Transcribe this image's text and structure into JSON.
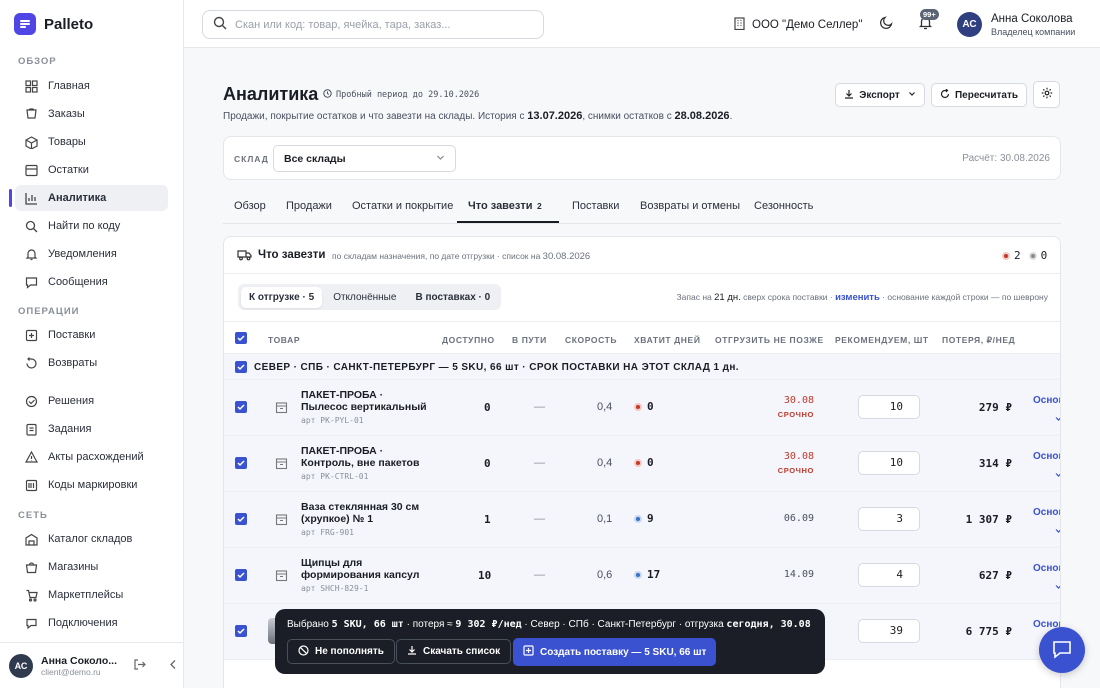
{
  "app": {
    "name": "Palleto"
  },
  "sidebar": {
    "sections": [
      {
        "title": "ОБЗОР"
      },
      {
        "title": "ОПЕРАЦИИ"
      },
      {
        "title": "СЕТЬ"
      }
    ],
    "items": [
      {
        "label": "Главная",
        "icon": "grid-icon"
      },
      {
        "label": "Заказы",
        "icon": "orders-icon"
      },
      {
        "label": "Товары",
        "icon": "products-icon"
      },
      {
        "label": "Остатки",
        "icon": "stock-icon"
      },
      {
        "label": "Аналитика",
        "icon": "chart-icon",
        "active": true
      },
      {
        "label": "Найти по коду",
        "icon": "search-code-icon"
      },
      {
        "label": "Уведомления",
        "icon": "bell-icon"
      },
      {
        "label": "Сообщения",
        "icon": "message-icon"
      },
      {
        "label": "Поставки",
        "icon": "supply-icon"
      },
      {
        "label": "Возвраты",
        "icon": "return-icon"
      },
      {
        "label": "Решения",
        "icon": "decision-icon"
      },
      {
        "label": "Задания",
        "icon": "tasks-icon"
      },
      {
        "label": "Акты расхождений",
        "icon": "acts-icon"
      },
      {
        "label": "Коды маркировки",
        "icon": "barcode-icon"
      },
      {
        "label": "Каталог складов",
        "icon": "warehouse-icon"
      },
      {
        "label": "Магазины",
        "icon": "store-icon"
      },
      {
        "label": "Маркетплейсы",
        "icon": "marketplace-icon"
      },
      {
        "label": "Подключения",
        "icon": "connections-icon"
      }
    ],
    "user": {
      "initials": "АС",
      "name": "Анна Соколо...",
      "email": "client@demo.ru"
    }
  },
  "header": {
    "search_placeholder": "Скан или код: товар, ячейка, тара, заказ...",
    "org": "ООО \"Демо Селлер\"",
    "notif_badge": "99+",
    "user": {
      "initials": "АС",
      "name": "Анна Соколова",
      "role": "Владелец компании"
    }
  },
  "page": {
    "title": "Аналитика",
    "trial": "Пробный период до 29.10.2026",
    "subtitle_pre": "Продажи, покрытие остатков и что завезти на склады. История с ",
    "history_date": "13.07.2026",
    "subtitle_mid": ", снимки остатков с ",
    "snapshot_date": "28.08.2026",
    "subtitle_end": ".",
    "export_label": "Экспорт",
    "recalc_label": "Пересчитать"
  },
  "filter": {
    "label": "СКЛАД",
    "value": "Все склады",
    "calc": "Расчёт: 30.08.2026"
  },
  "tabs": [
    {
      "label": "Обзор"
    },
    {
      "label": "Продажи"
    },
    {
      "label": "Остатки и покрытие"
    },
    {
      "label": "Что завезти",
      "count": "2",
      "active": true
    },
    {
      "label": "Поставки"
    },
    {
      "label": "Возвраты и отмены"
    },
    {
      "label": "Сезонность"
    }
  ],
  "card": {
    "title": "Что завезти",
    "desc": "по складам назначения, по дате отгрузки · список на ",
    "desc_date": "30.08.2026",
    "red_count": "2",
    "gray_count": "0",
    "segments": [
      {
        "label": "К отгрузке · 5",
        "active": true
      },
      {
        "label": "Отклонённые"
      },
      {
        "label": "В поставках · 0"
      }
    ],
    "note_pre": "Запас на ",
    "note_days": "21 дн.",
    "note_mid": " сверх срока поставки · ",
    "note_link": "изменить",
    "note_end": " · основание каждой строки — по шеврону"
  },
  "table": {
    "columns": [
      "ТОВАР",
      "ДОСТУПНО",
      "В ПУТИ",
      "СКОРОСТЬ",
      "ХВАТИТ ДНЕЙ",
      "ОТГРУЗИТЬ НЕ ПОЗЖЕ",
      "РЕКОМЕНДУЕМ, ШТ",
      "ПОТЕРЯ, ₽/НЕД"
    ],
    "group": "СЕВЕР · СПБ · САНКТ-ПЕТЕРБУРГ — 5 SKU, 66 шт · СРОК ПОСТАВКИ НА ЭТОТ СКЛАД 1 дн.",
    "basis_label": "Основ",
    "rows": [
      {
        "name": "ПАКЕТ-ПРОБА · Пылесос вертикальный",
        "art": "арт PK-PYL-01",
        "avail": "0",
        "transit": "—",
        "speed": "0,4",
        "days": "0",
        "days_color": "#c0392b",
        "ship": "30.08",
        "urgent": "СРОЧНО",
        "rec": "10",
        "loss": "279 ₽"
      },
      {
        "name": "ПАКЕТ-ПРОБА · Контроль, вне пакетов",
        "art": "арт PK-CTRL-01",
        "avail": "0",
        "transit": "—",
        "speed": "0,4",
        "days": "0",
        "days_color": "#c0392b",
        "ship": "30.08",
        "urgent": "СРОЧНО",
        "rec": "10",
        "loss": "314 ₽"
      },
      {
        "name": "Ваза стеклянная 30 см (хрупкое) № 1",
        "art": "арт FRG-901",
        "avail": "1",
        "transit": "—",
        "speed": "0,1",
        "days": "9",
        "days_color": "#3a6fc4",
        "ship": "06.09",
        "urgent": "",
        "rec": "3",
        "loss": "1 307 ₽"
      },
      {
        "name": "Щипцы для формирования капсул",
        "art": "арт SHCH-829-1",
        "avail": "10",
        "transit": "—",
        "speed": "0,6",
        "days": "17",
        "days_color": "#3a6fc4",
        "ship": "14.09",
        "urgent": "",
        "rec": "4",
        "loss": "627 ₽"
      },
      {
        "name": "",
        "art": "",
        "avail": "",
        "transit": "",
        "speed": "",
        "days": "",
        "days_color": "#3a6fc4",
        "ship": "",
        "urgent": "",
        "rec": "39",
        "loss": "6 775 ₽"
      }
    ]
  },
  "actionbar": {
    "sel_pre": "Выбрано ",
    "sel_val": "5 SKU, 66 шт",
    "loss_pre": " · потеря ≈ ",
    "loss_val": "9 302 ₽/нед",
    "dest": " · Север · СПб · Санкт-Петербург · отгрузка ",
    "ship_val": "сегодня, 30.08",
    "btn_skip": "Не пополнять",
    "btn_download": "Скачать список",
    "btn_create": "Создать поставку — 5 SKU, 66 шт"
  },
  "colors": {
    "accent": "#3a52d0",
    "brand": "#4f46e5",
    "danger": "#c0392b",
    "info": "#3a6fc4"
  }
}
